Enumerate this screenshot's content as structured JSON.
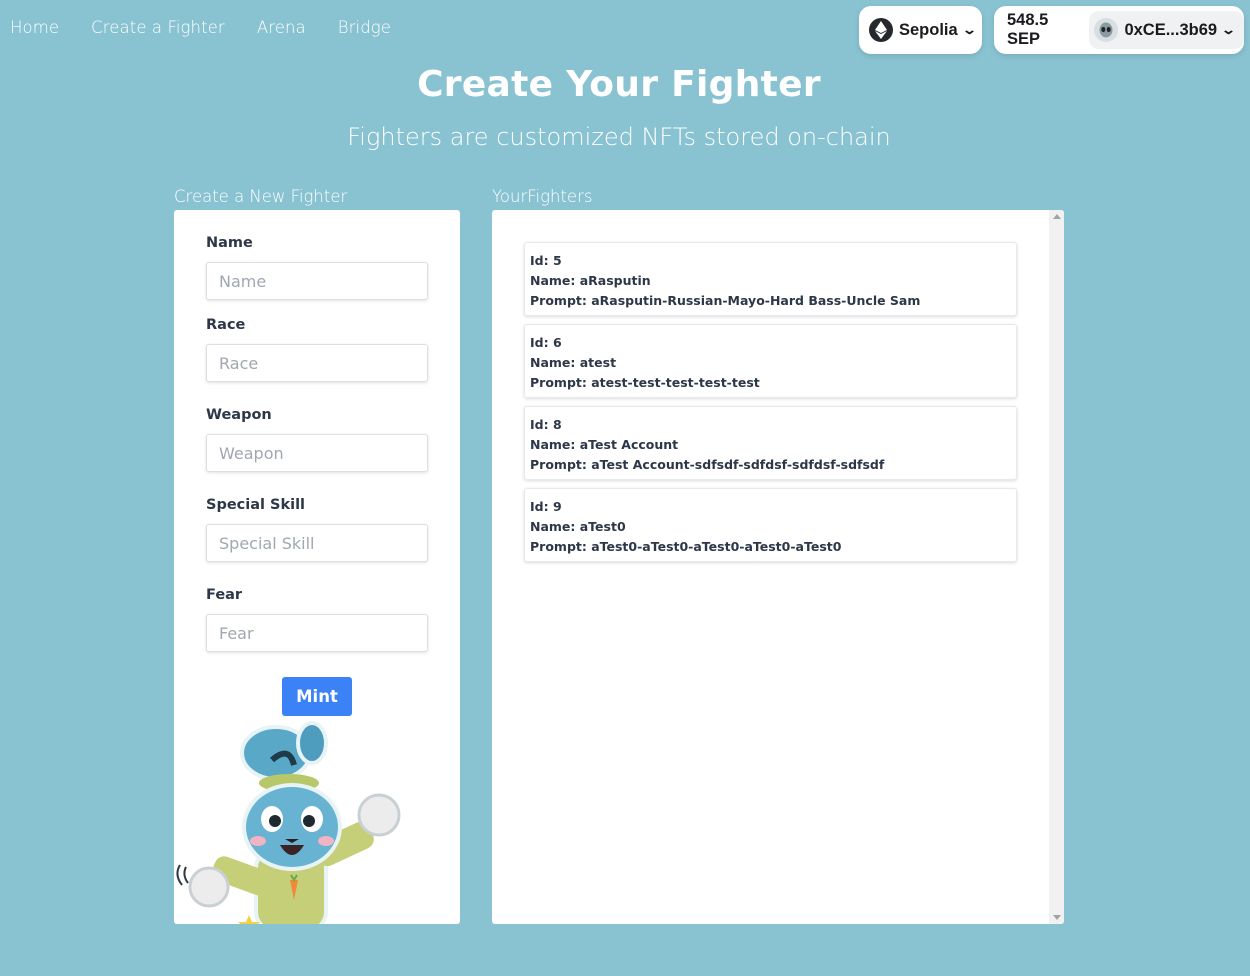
{
  "nav": {
    "items": [
      "Home",
      "Create a Fighter",
      "Arena",
      "Bridge"
    ]
  },
  "wallet": {
    "network": "Sepolia",
    "network_icon": "ethereum-icon",
    "balance": "548.5 SEP",
    "address": "0xCE...3b69",
    "avatar_icon": "alien-avatar-icon"
  },
  "hero": {
    "title": "Create Your Fighter",
    "subtitle": "Fighters are customized NFTs stored on-chain"
  },
  "form": {
    "section_label": "Create a New Fighter",
    "fields": [
      {
        "label": "Name",
        "placeholder": "Name"
      },
      {
        "label": "Race",
        "placeholder": "Race"
      },
      {
        "label": "Weapon",
        "placeholder": "Weapon"
      },
      {
        "label": "Special Skill",
        "placeholder": "Special Skill"
      },
      {
        "label": "Fear",
        "placeholder": "Fear"
      }
    ],
    "submit_label": "Mint"
  },
  "fighters": {
    "section_label": "YourFighters",
    "items": [
      {
        "id": "Id: 5",
        "name": "Name: aRasputin",
        "prompt": "Prompt: aRasputin-Russian-Mayo-Hard Bass-Uncle Sam"
      },
      {
        "id": "Id: 6",
        "name": "Name: atest",
        "prompt": "Prompt: atest-test-test-test-test"
      },
      {
        "id": "Id: 8",
        "name": "Name: aTest Account",
        "prompt": "Prompt: aTest Account-sdfsdf-sdfdsf-sdfdsf-sdfsdf"
      },
      {
        "id": "Id: 9",
        "name": "Name: aTest0",
        "prompt": "Prompt: aTest0-aTest0-aTest0-aTest0-aTest0"
      }
    ]
  },
  "colors": {
    "background": "#89c3d2",
    "primary_button": "#3b82f6",
    "card": "#ffffff"
  }
}
